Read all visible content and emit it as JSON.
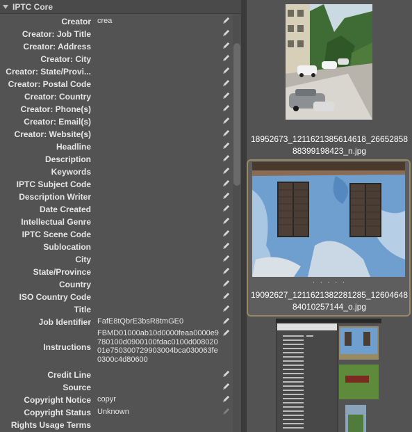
{
  "section": {
    "title": "IPTC Core"
  },
  "fields": [
    {
      "label": "Creator",
      "value": "crea"
    },
    {
      "label": "Creator: Job Title",
      "value": ""
    },
    {
      "label": "Creator: Address",
      "value": ""
    },
    {
      "label": "Creator: City",
      "value": ""
    },
    {
      "label": "Creator: State/Provi...",
      "value": ""
    },
    {
      "label": "Creator: Postal Code",
      "value": ""
    },
    {
      "label": "Creator: Country",
      "value": ""
    },
    {
      "label": "Creator: Phone(s)",
      "value": ""
    },
    {
      "label": "Creator: Email(s)",
      "value": ""
    },
    {
      "label": "Creator: Website(s)",
      "value": ""
    },
    {
      "label": "Headline",
      "value": ""
    },
    {
      "label": "Description",
      "value": ""
    },
    {
      "label": "Keywords",
      "value": ""
    },
    {
      "label": "IPTC Subject Code",
      "value": ""
    },
    {
      "label": "Description Writer",
      "value": ""
    },
    {
      "label": "Date Created",
      "value": ""
    },
    {
      "label": "Intellectual Genre",
      "value": ""
    },
    {
      "label": "IPTC Scene Code",
      "value": ""
    },
    {
      "label": "Sublocation",
      "value": ""
    },
    {
      "label": "City",
      "value": ""
    },
    {
      "label": "State/Province",
      "value": ""
    },
    {
      "label": "Country",
      "value": ""
    },
    {
      "label": "ISO Country Code",
      "value": ""
    },
    {
      "label": "Title",
      "value": ""
    },
    {
      "label": "Job Identifier",
      "value": "FafE8tQbrE3bsR8tmGE0"
    },
    {
      "label": "Instructions",
      "value": "FBMD01000ab10d0000feaa0000e9780100d0900100fdac0100d00802001e750300729903004bca030063fe0300c4d80600"
    },
    {
      "label": "Credit Line",
      "value": ""
    },
    {
      "label": "Source",
      "value": ""
    },
    {
      "label": "Copyright Notice",
      "value": "copyr"
    },
    {
      "label": "Copyright Status",
      "value": "Unknown"
    },
    {
      "label": "Rights Usage Terms",
      "value": ""
    }
  ],
  "thumbnails": [
    {
      "filename": "18952673_1211621385614618_2665285888399198423_n.jpg",
      "selected": false
    },
    {
      "filename": "19092627_1211621382281285_1260464884010257144_o.jpg",
      "selected": true
    },
    {
      "filename": "",
      "selected": false
    }
  ],
  "rating_dots": "· · · · ·",
  "colors": {
    "panel_bg": "#535353",
    "selection_border": "#9a8a63",
    "label_text": "#e6e6e6"
  },
  "icons": {
    "edit": "pencil-edit-icon",
    "collapse": "triangle-down-icon"
  }
}
